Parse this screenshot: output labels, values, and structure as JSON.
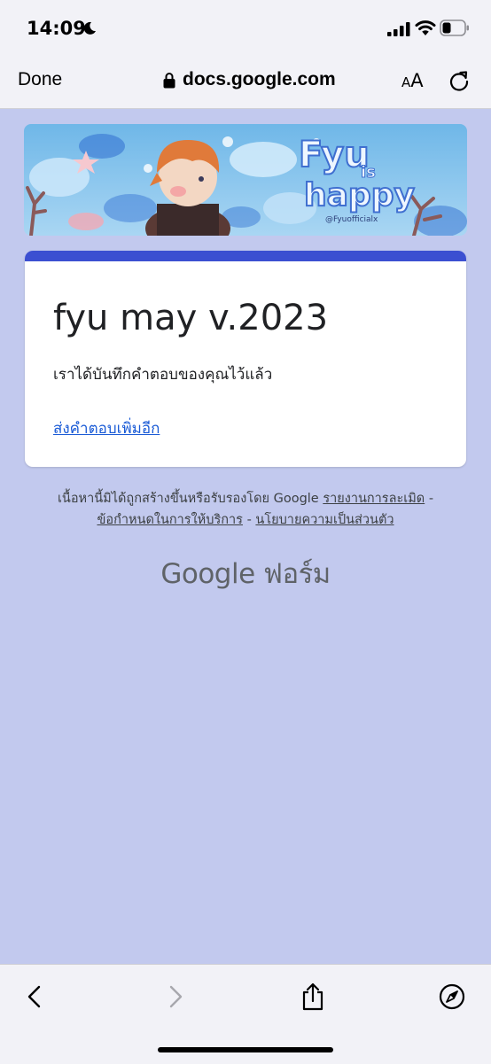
{
  "status_bar": {
    "time": "14:09",
    "icons": [
      "moon-icon",
      "signal-icon",
      "wifi-icon",
      "battery-icon"
    ]
  },
  "browser": {
    "done_label": "Done",
    "url": "docs.google.com",
    "text_size_small": "A",
    "text_size_large": "A"
  },
  "banner": {
    "title_line1": "Fyu",
    "title_line2": "is",
    "title_line3": "happy",
    "credit": "@Fyuofficialx"
  },
  "form": {
    "title": "fyu may v.2023",
    "confirmation": "เราได้บันทึกคำตอบของคุณไว้แล้ว",
    "submit_another": "ส่งคำตอบเพิ่มอีก"
  },
  "footer": {
    "disclaimer": "เนื้อหานี้มิได้ถูกสร้างขึ้นหรือรับรองโดย Google",
    "report_abuse": "รายงานการละเมิด",
    "separator": "-",
    "terms": "ข้อกำหนดในการให้บริการ",
    "privacy": "นโยบายความเป็นส่วนตัว",
    "logo": "Google ฟอร์ม"
  },
  "toolbar": {
    "icons": [
      "back-icon",
      "forward-icon",
      "share-icon",
      "compass-icon"
    ]
  },
  "colors": {
    "page_background": "#c2c9ee",
    "card_accent": "#3b4fd1",
    "link": "#1a5bd6",
    "chrome_background": "#f2f2f7"
  }
}
